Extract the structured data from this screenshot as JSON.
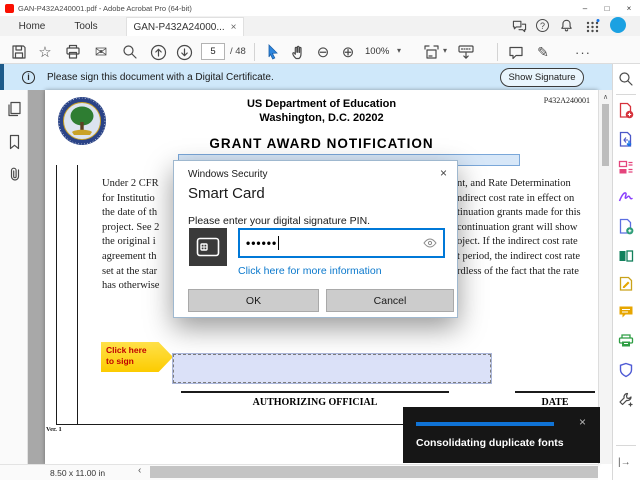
{
  "window": {
    "title": "GAN-P432A240001.pdf - Adobe Acrobat Pro (64-bit)",
    "minimize": "–",
    "maximize": "□",
    "close": "×"
  },
  "tabbar": {
    "home": "Home",
    "tools": "Tools",
    "doc_tab": "GAN-P432A24000...",
    "doc_tab_close": "×"
  },
  "toolbar": {
    "page_current": "5",
    "page_total": "/ 48",
    "zoom_level": "100%"
  },
  "notifbar": {
    "info_glyph": "i",
    "message": "Please sign this document with a Digital Certificate.",
    "show_signature": "Show Signature"
  },
  "page": {
    "doc_number": "P432A240001",
    "dept_line1": "US Department of Education",
    "dept_line2": "Washington, D.C. 20202",
    "title": "GRANT AWARD NOTIFICATION",
    "body_left": [
      "Under 2 CFR",
      "for Institutio",
      "the date of th",
      "project. See 2",
      "the original i",
      "agreement th",
      "set at the star",
      "has otherwise"
    ],
    "body_right": [
      "nt, and Rate Determination",
      "ndirect cost rate in effect on",
      "tinuation grants made for this",
      "continuation grant will show",
      "oject. If the indirect cost rate",
      "t period, the indirect cost rate",
      "rdless of the fact that the rate"
    ],
    "callout_line1": "Click here",
    "callout_line2": "to sign",
    "authorizing_official": "AUTHORIZING OFFICIAL",
    "date_label": "DATE",
    "version": "Ver. 1"
  },
  "dialog": {
    "window_title": "Windows Security",
    "close": "×",
    "title": "Smart Card",
    "prompt": "Please enter your digital signature PIN.",
    "pin_masked": "••••••",
    "link": "Click here for more information",
    "ok": "OK",
    "cancel": "Cancel"
  },
  "toast": {
    "message": "Consolidating duplicate fonts",
    "close": "×"
  },
  "statusbar": {
    "page_size": "8.50 x 11.00 in",
    "scroll_left": "‹"
  },
  "icons": {
    "star": "☆",
    "envelope": "✉",
    "zoom_out": "⊖",
    "zoom_in": "⊕",
    "caret_down": "▾",
    "highlighter": "✎",
    "more": "···",
    "help": "?",
    "scroll_up": "∧",
    "collapse_panel": "|→"
  },
  "colors": {
    "accent_blue": "#0078d7",
    "notification_bg": "#cfe8fa",
    "toast_progress": "#1073d5",
    "callout_yellow": "#fccb00",
    "callout_text": "#c00000",
    "signature_field_bg": "#dbe1f8",
    "acrobat_red": "#fa0f00"
  }
}
